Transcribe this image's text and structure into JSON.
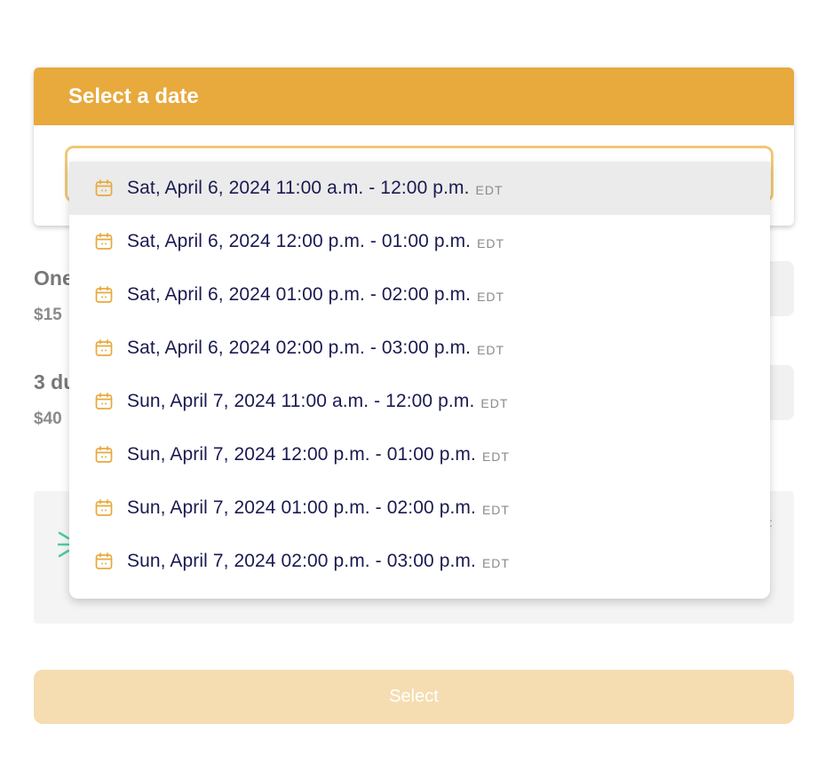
{
  "card": {
    "header_title": "Select a date"
  },
  "options": [
    {
      "title": "One",
      "price": "$15"
    },
    {
      "title": "3 du",
      "price": "$40"
    }
  ],
  "dropdown": {
    "items": [
      {
        "label": "Sat, April 6, 2024 11:00 a.m. - 12:00 p.m.",
        "tz": "EDT",
        "icon": "calendar-icon",
        "highlighted": true
      },
      {
        "label": "Sat, April 6, 2024 12:00 p.m. - 01:00 p.m.",
        "tz": "EDT",
        "icon": "calendar-icon"
      },
      {
        "label": "Sat, April 6, 2024 01:00 p.m. - 02:00 p.m.",
        "tz": "EDT",
        "icon": "calendar-icon"
      },
      {
        "label": "Sat, April 6, 2024 02:00 p.m. - 03:00 p.m.",
        "tz": "EDT",
        "icon": "calendar-icon"
      },
      {
        "label": "Sun, April 7, 2024 11:00 a.m. - 12:00 p.m.",
        "tz": "EDT",
        "icon": "calendar-icon"
      },
      {
        "label": "Sun, April 7, 2024 12:00 p.m. - 01:00 p.m.",
        "tz": "EDT",
        "icon": "calendar-icon"
      },
      {
        "label": "Sun, April 7, 2024 01:00 p.m. - 02:00 p.m.",
        "tz": "EDT",
        "icon": "calendar-icon"
      },
      {
        "label": "Sun, April 7, 2024 02:00 p.m. - 03:00 p.m.",
        "tz": "EDT",
        "icon": "calendar-icon"
      }
    ]
  },
  "footer": {
    "select_label": "Select"
  },
  "colors": {
    "accent": "#e8a93d",
    "item_text": "#1a1a52",
    "highlight_bg": "#ebebeb",
    "button_disabled_bg": "#f5ddb1",
    "spinner_teal": "#4cc9a8"
  }
}
